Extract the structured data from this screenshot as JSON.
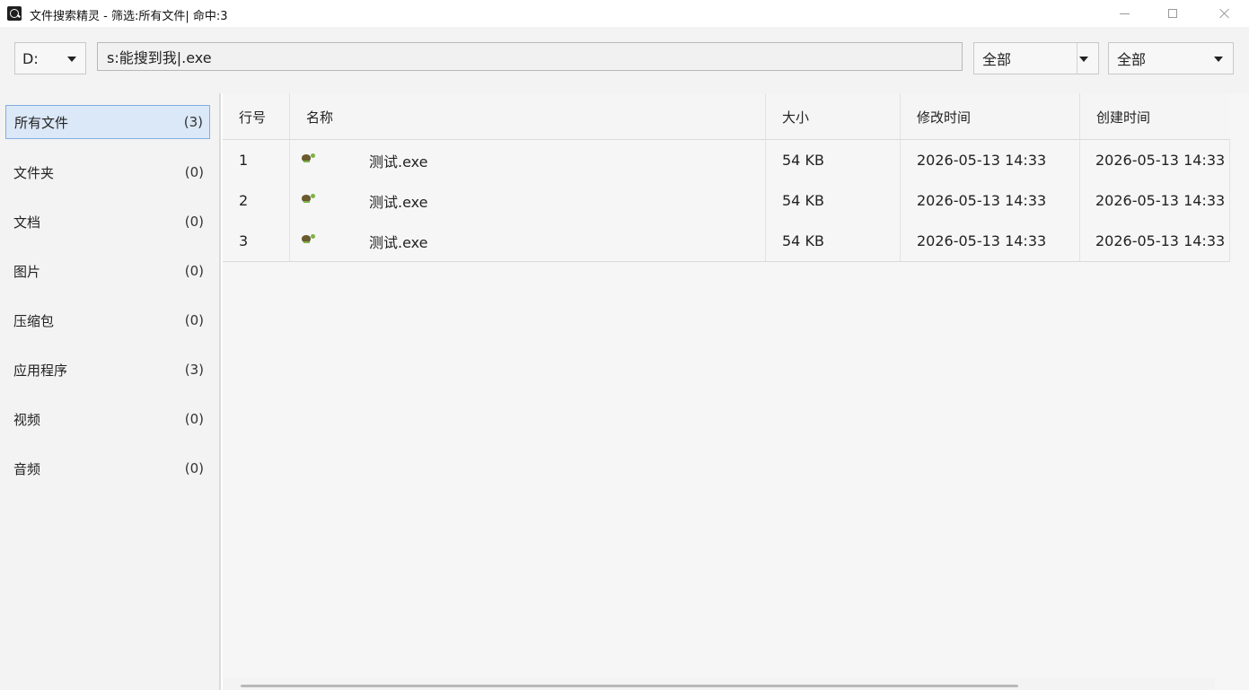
{
  "window": {
    "title": "文件搜索精灵 - 筛选:所有文件| 命中:3",
    "icon": "search-app-icon",
    "controls": [
      "minimize-icon",
      "maximize-icon",
      "close-icon"
    ]
  },
  "toolbar": {
    "drive": "D:",
    "search_value": "s:能搜到我|.exe",
    "filter_1": "全部",
    "filter_2": "全部"
  },
  "sidebar": {
    "items": [
      {
        "label": "所有文件",
        "count": "(3)",
        "active": true
      },
      {
        "label": "文件夹",
        "count": "(0)"
      },
      {
        "label": "文档",
        "count": "(0)"
      },
      {
        "label": "图片",
        "count": "(0)"
      },
      {
        "label": "压缩包",
        "count": "(0)"
      },
      {
        "label": "应用程序",
        "count": "(3)"
      },
      {
        "label": "视频",
        "count": "(0)"
      },
      {
        "label": "音频",
        "count": "(0)"
      }
    ]
  },
  "table": {
    "columns": [
      "行号",
      "名称",
      "大小",
      "修改时间",
      "创建时间"
    ],
    "rows": [
      {
        "line": "1",
        "name": "测试.exe",
        "size": "54 KB",
        "modified": "2026-05-13 14:33",
        "created": "2026-05-13 14:33",
        "icon": "turtle-exe-icon"
      },
      {
        "line": "2",
        "name": "测试.exe",
        "size": "54 KB",
        "modified": "2026-05-13 14:33",
        "created": "2026-05-13 14:33",
        "icon": "turtle-exe-icon"
      },
      {
        "line": "3",
        "name": "测试.exe",
        "size": "54 KB",
        "modified": "2026-05-13 14:33",
        "created": "2026-05-13 14:33",
        "icon": "turtle-exe-icon"
      }
    ]
  },
  "colors": {
    "active_bg": "#dbe8f7",
    "active_border": "#85aee0",
    "panel_bg": "#f3f3f3",
    "table_bg": "#f6f6f6"
  }
}
